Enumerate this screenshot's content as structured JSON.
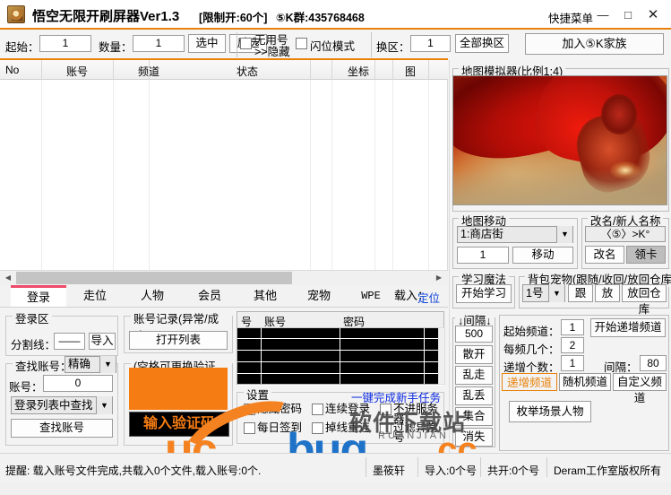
{
  "titlebar": {
    "app_name": "悟空无限开刷屏器Ver1.3",
    "limit": "[限制开:60个]",
    "qq_group": "⑤K群:435768468",
    "quick_menu": "快捷菜单",
    "minimize": "—",
    "maximize": "□",
    "close": "✕"
  },
  "toolbar": {
    "start_label": "起始：",
    "start_value": "1",
    "count_label": "数量：",
    "count_value": "1",
    "select_btn": "选中",
    "invert_btn": "反选",
    "unused_hide_line1": "无用号",
    "unused_hide_line2": ">>隐藏",
    "flash_mode": "闪位模式",
    "change_zone_label": "换区：",
    "change_zone_value": "1",
    "change_all_btn": "全部换区",
    "join_family_btn": "加入⑤K家族"
  },
  "list": {
    "columns": [
      "No",
      "账号",
      "频道",
      "状态",
      "坐标",
      "图"
    ]
  },
  "tabs": {
    "items": [
      "登录",
      "走位",
      "人物",
      "会员",
      "其他",
      "宠物",
      "WPE",
      "载入："
    ],
    "active": "登录",
    "locate": "定位"
  },
  "login_tab": {
    "login_zone_cap": "登录区",
    "divider_label": "分割线：",
    "divider_value": "——",
    "import_btn": "导入",
    "find_acct_cap": "查找账号：",
    "find_mode": "精确",
    "acct_label": "账号：",
    "acct_value": "0",
    "find_scope": "登录列表中查找",
    "find_btn": "查找账号",
    "record_cap": "账号记录(异常/成功)",
    "open_list_btn": "打开列表",
    "captcha_cap": "(空格可更换验证码)",
    "captcha_input": "输入验证码",
    "table_headers": [
      "号",
      "账号",
      "密码"
    ],
    "settings_cap": "设置",
    "onekey_task": "一键完成新手任务",
    "checkboxes": [
      "隐藏密码",
      "连续登录",
      "不进服务器",
      "每日签到",
      "掉线重连",
      "过滤异常号"
    ]
  },
  "right_panel": {
    "map_sim_cap": "地图模拟器(比例1:4)",
    "map_move_cap": "地图移动",
    "map_select": "1:商店街",
    "map_coord": "1",
    "move_btn": "移动",
    "rename_cap": "改名/新人名称",
    "rename_value": "〈⑤〉>K°",
    "rename_btn": "改名",
    "getcard_btn": "领卡",
    "learn_magic_cap": "学习魔法",
    "start_learn_btn": "开始学习",
    "pet_cap": "背包宠物(跟随/收回/放回仓库)",
    "pet_select": "1号",
    "pet_follow_btn": "跟",
    "pet_release_btn": "放",
    "pet_store_btn": "放回仓库",
    "interval_cap": "↓间隔↓",
    "interval_value": "500",
    "move_buttons": [
      "散开",
      "乱走",
      "乱丢",
      "集合",
      "消失"
    ],
    "start_channel_label": "起始频道：",
    "start_channel_value": "1",
    "per_channel_label": "每频几个：",
    "per_channel_value": "2",
    "inc_count_label": "递增个数：",
    "inc_count_value": "1",
    "start_inc_btn": "开始递增频道",
    "interval2_label": "间隔：",
    "interval2_value": "80",
    "chan_tabs": [
      "递增频道",
      "随机频道",
      "自定义频道"
    ],
    "chan_tab_active": "递增频道",
    "enum_scene_btn": "枚举场景人物"
  },
  "statusbar": {
    "tip": "提醒: 载入账号文件完成,共载入0个文件,载入账号:0个.",
    "author": "墨筱轩",
    "imported": "导入:0个号",
    "opened": "共开:0个号",
    "copyright": "Deram工作室版权所有"
  },
  "watermark": {
    "site_cn": "软件下载站",
    "uc": "uc",
    "bug": "bug",
    "cc": ".cc",
    "sub": "RUANJIAN"
  },
  "colors": {
    "accent": "#e8820c",
    "tab_active": "#ee4b6a",
    "link": "#0a3fd8",
    "captcha": "#f57c12"
  }
}
